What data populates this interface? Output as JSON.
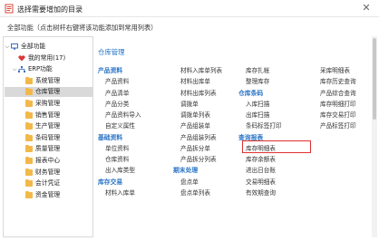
{
  "window": {
    "title": "选择需要增加的目录",
    "close_glyph": "✕"
  },
  "hint": "全部功能（点击树杆右键将该功能添加到常用列表）",
  "tree": {
    "root": "全部功能",
    "favorites": "我的常用(17)",
    "erp": "ERP功能",
    "items": [
      "系统管理",
      "仓库管理",
      "采购管理",
      "销售管理",
      "生产管理",
      "条码管理",
      "质量管理",
      "报表中心",
      "财务管理",
      "会计凭证",
      "资金管理"
    ],
    "selected": "仓库管理"
  },
  "content": {
    "section_title": "仓库管理",
    "columns": [
      {
        "groups": [
          {
            "category": "产品资料",
            "items": [
              "产品资料",
              "产品清单",
              "产品分类",
              "产品资料导入",
              "自定义属性"
            ]
          },
          {
            "category": "基础资料",
            "items": [
              "单位资料",
              "仓库资料",
              "出入库类型"
            ]
          },
          {
            "category": "库存交易",
            "items": [
              "材料入库单"
            ]
          }
        ]
      },
      {
        "groups": [
          {
            "category": "",
            "items": [
              "材料入库单列表",
              "材料出库单",
              "材料出库列表",
              "调拨单",
              "调拨单列表",
              "产品组装单",
              "产品组装列表",
              "产品拆分单",
              "产品拆分列表"
            ]
          },
          {
            "category": "期末处理",
            "items": [
              "盘点单",
              "盘点单列表"
            ]
          }
        ]
      },
      {
        "groups": [
          {
            "category": "",
            "items": [
              "库存扎帐",
              "整理库存"
            ]
          },
          {
            "category": "仓库条码",
            "items": [
              "入库扫描",
              "出库扫描",
              "条码标签打印"
            ]
          },
          {
            "category": "查询报表",
            "items": [
              "库存明细表",
              "库存余额表",
              "进出日台账",
              "交易明细表",
              "有效期查询"
            ]
          }
        ]
      },
      {
        "groups": [
          {
            "category": "",
            "items": [
              "采库明细表",
              "库存历史查询",
              "产品综合查询",
              "库存明细打印",
              "库存交易打印",
              "产品标签打印"
            ]
          }
        ]
      }
    ],
    "highlighted": "库存明细表"
  },
  "colors": {
    "accent": "#1e6fc9",
    "highlight": "#e03030",
    "folder": "#f2b94a"
  }
}
